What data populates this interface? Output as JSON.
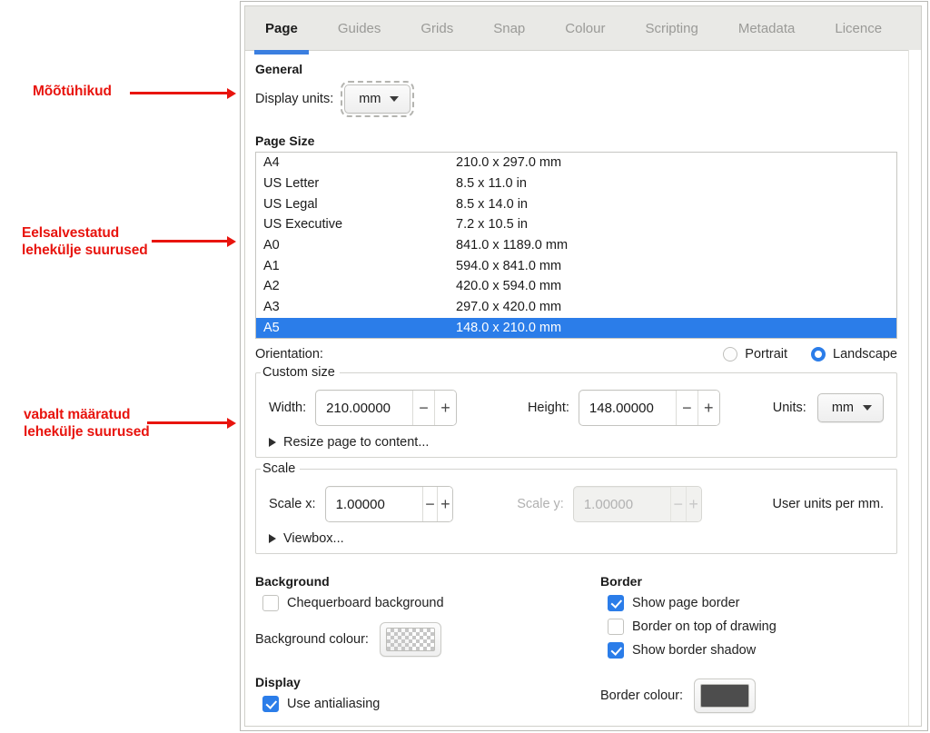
{
  "annotations": [
    {
      "text": "Mõõtühikud",
      "color": "#e8140e"
    },
    {
      "text": "Eelsalvestatud\nlehekülje suurused",
      "color": "#e8140e"
    },
    {
      "text": "vabalt määratud\nlehekülje suurused",
      "color": "#e8140e"
    }
  ],
  "tabs": [
    {
      "label": "Page",
      "active": true
    },
    {
      "label": "Guides",
      "active": false
    },
    {
      "label": "Grids",
      "active": false
    },
    {
      "label": "Snap",
      "active": false
    },
    {
      "label": "Colour",
      "active": false
    },
    {
      "label": "Scripting",
      "active": false
    },
    {
      "label": "Metadata",
      "active": false
    },
    {
      "label": "Licence",
      "active": false
    }
  ],
  "general": {
    "title": "General",
    "display_units_label": "Display units:",
    "display_units_value": "mm"
  },
  "page_size": {
    "title": "Page Size",
    "rows": [
      {
        "name": "A4",
        "dims": "210.0 x 297.0 mm",
        "selected": false
      },
      {
        "name": "US Letter",
        "dims": "8.5 x 11.0 in",
        "selected": false
      },
      {
        "name": "US Legal",
        "dims": "8.5 x 14.0 in",
        "selected": false
      },
      {
        "name": "US Executive",
        "dims": "7.2 x 10.5 in",
        "selected": false
      },
      {
        "name": "A0",
        "dims": "841.0 x 1189.0 mm",
        "selected": false
      },
      {
        "name": "A1",
        "dims": "594.0 x 841.0 mm",
        "selected": false
      },
      {
        "name": "A2",
        "dims": "420.0 x 594.0 mm",
        "selected": false
      },
      {
        "name": "A3",
        "dims": "297.0 x 420.0 mm",
        "selected": false
      },
      {
        "name": "A5",
        "dims": "148.0 x 210.0 mm",
        "selected": true
      }
    ]
  },
  "orientation": {
    "label": "Orientation:",
    "portrait_label": "Portrait",
    "landscape_label": "Landscape",
    "selected": "Landscape"
  },
  "custom_size": {
    "legend": "Custom size",
    "width_label": "Width:",
    "width_value": "210.00000",
    "height_label": "Height:",
    "height_value": "148.00000",
    "units_label": "Units:",
    "units_value": "mm",
    "resize_label": "Resize page to content...",
    "minus": "−",
    "plus": "+"
  },
  "scale": {
    "legend": "Scale",
    "scale_x_label": "Scale x:",
    "scale_x_value": "1.00000",
    "scale_y_label": "Scale y:",
    "scale_y_value": "1.00000",
    "scale_y_disabled": true,
    "user_units_label": "User units per mm.",
    "viewbox_label": "Viewbox...",
    "minus": "−",
    "plus": "+"
  },
  "background": {
    "title": "Background",
    "chequerboard_label": "Chequerboard background",
    "chequerboard_checked": false,
    "colour_label": "Background colour:",
    "colour_value": "transparent-white"
  },
  "display": {
    "title": "Display",
    "antialiasing_label": "Use antialiasing",
    "antialiasing_checked": true
  },
  "border": {
    "title": "Border",
    "show_page_border_label": "Show page border",
    "show_page_border_checked": true,
    "border_on_top_label": "Border on top of drawing",
    "border_on_top_checked": false,
    "show_border_shadow_label": "Show border shadow",
    "show_border_shadow_checked": true,
    "colour_label": "Border colour:",
    "colour_value": "#4d4d4d"
  },
  "theme": {
    "accent": "#2b7de9",
    "annotation": "#e8140e"
  }
}
